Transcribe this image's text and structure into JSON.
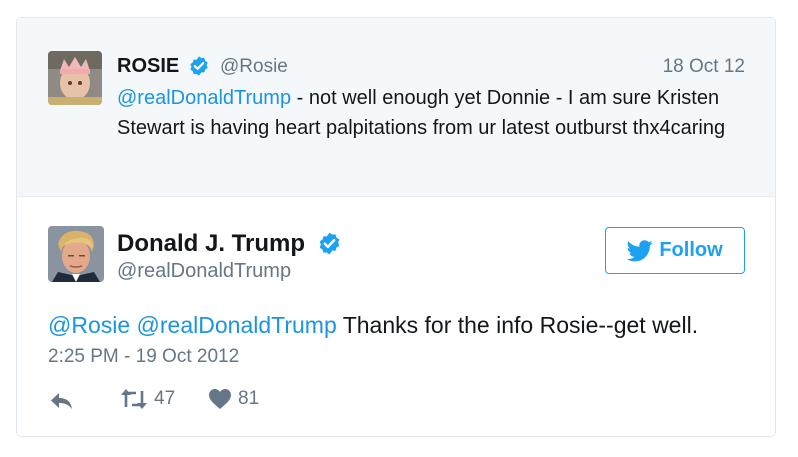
{
  "quoted_tweet": {
    "author_name": "ROSIE",
    "handle": "@Rosie",
    "date": "18 Oct 12",
    "mention": "@realDonaldTrump",
    "text": " - not well enough yet Donnie - I am sure Kristen Stewart is having heart palpitations from ur latest outburst thx4caring"
  },
  "main_tweet": {
    "author_name": "Donald J. Trump",
    "handle": "@realDonaldTrump",
    "follow_label": "Follow",
    "mention_1": "@Rosie",
    "mention_2": "@realDonaldTrump",
    "text": " Thanks for the info Rosie--get well.",
    "timestamp": "2:25 PM - 19 Oct 2012",
    "retweet_count": "47",
    "like_count": "81"
  },
  "colors": {
    "link": "#1b95e0",
    "accent": "#1da1f2",
    "muted": "#657786",
    "quoted_bg": "#f5f8fa"
  },
  "icons": [
    "verified-badge-icon",
    "twitter-bird-icon",
    "reply-icon",
    "retweet-icon",
    "heart-icon"
  ]
}
